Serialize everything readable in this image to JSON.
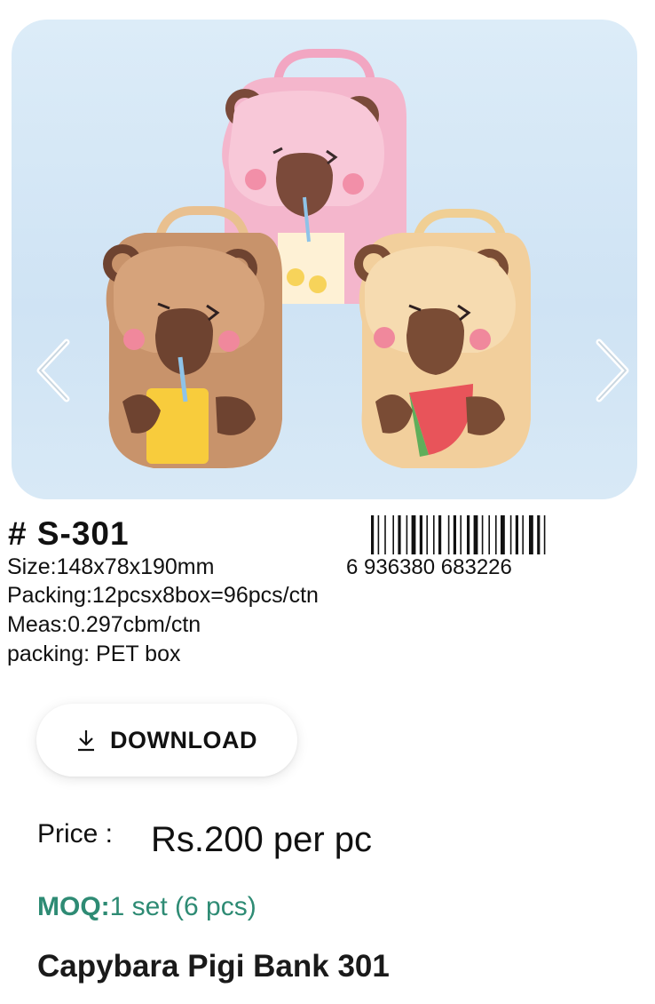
{
  "product": {
    "sku": "# S-301",
    "size": "Size:148x78x190mm",
    "packing": "Packing:12pcsx8box=96pcs/ctn",
    "meas": "Meas:0.297cbm/ctn",
    "packing_type": "packing: PET box",
    "barcode_number": "6 936380 683226",
    "title": "Capybara Pigi Bank 301"
  },
  "carousel": {
    "prev_icon": "chevron-left-icon",
    "next_icon": "chevron-right-icon",
    "image": "three capybara tin coin banks: pink, brown and beige"
  },
  "download": {
    "label": "DOWNLOAD",
    "icon": "download-icon"
  },
  "price": {
    "label": "Price :",
    "value": "Rs.200 per pc"
  },
  "moq": {
    "label": "MOQ:",
    "value": "1 set (6 pcs)"
  },
  "colors": {
    "moq": "#2e8b74",
    "pink_bank": "#f7b8cf",
    "brown_bank": "#c9946a",
    "beige_bank": "#f4d1a0"
  }
}
